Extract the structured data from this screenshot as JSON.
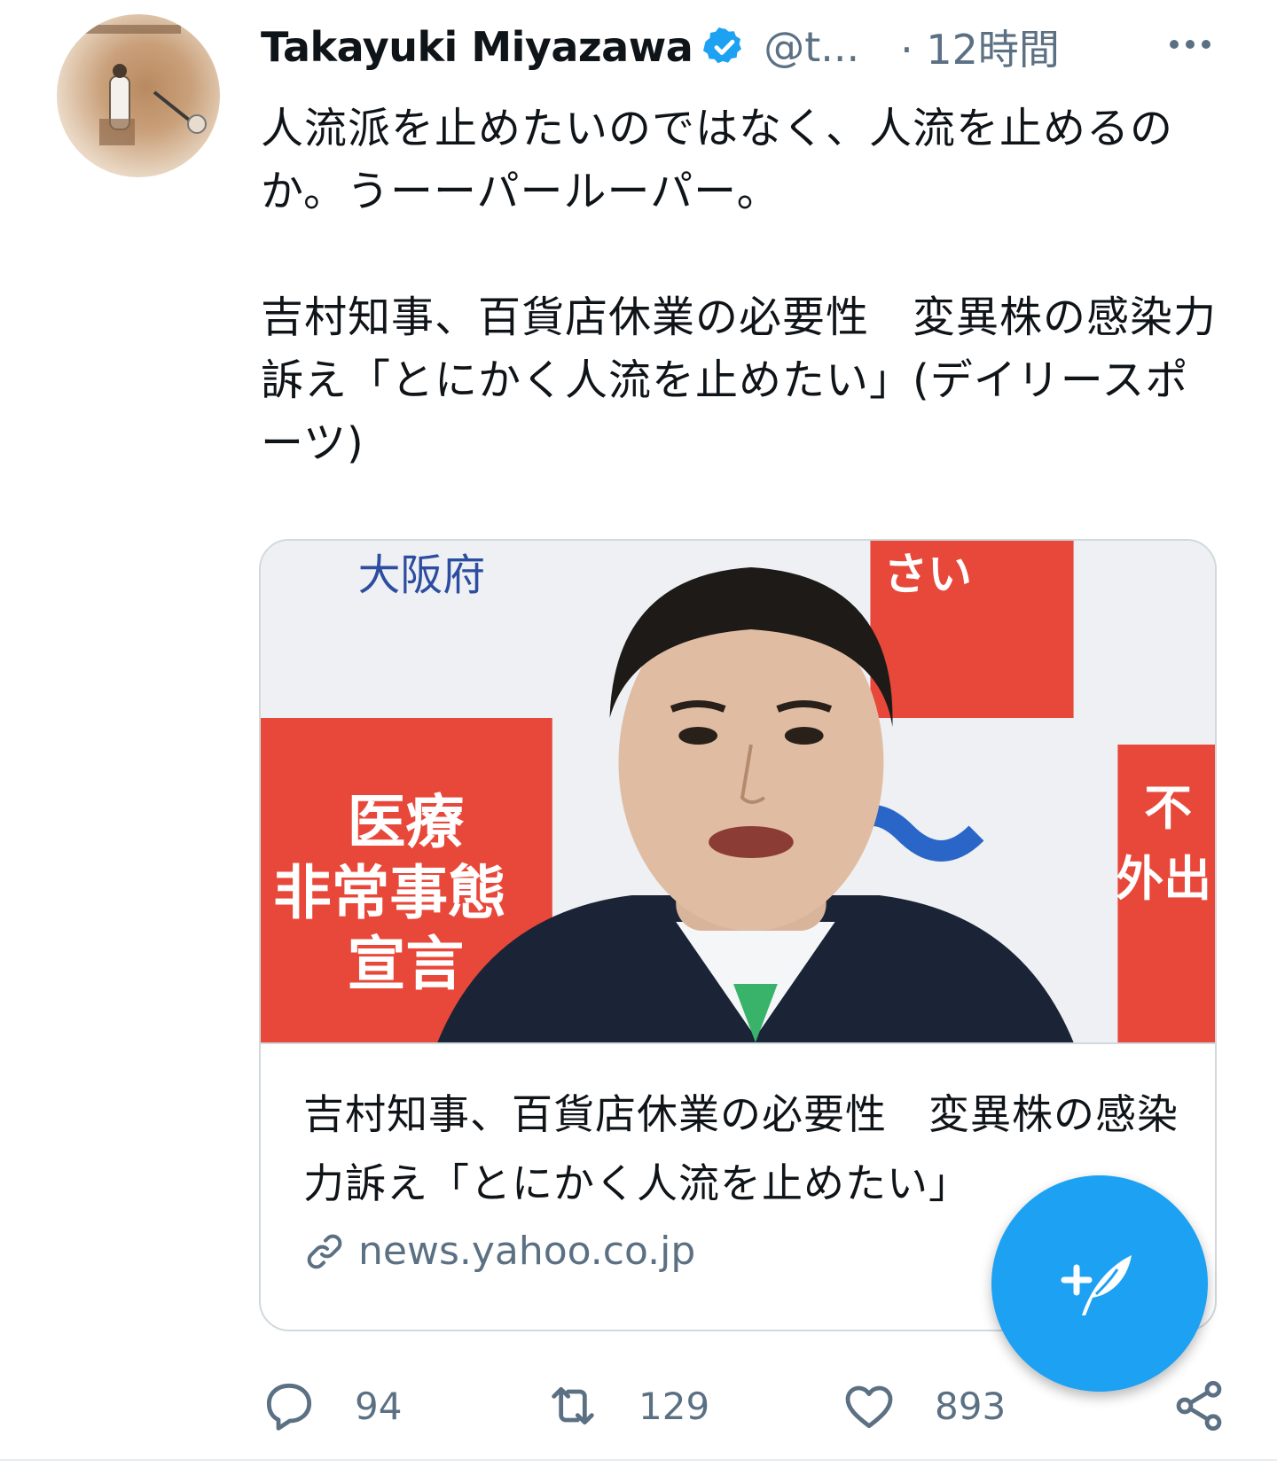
{
  "tweet": {
    "author_name": "Takayuki Miyazawa",
    "handle": "@t...",
    "time": "· 12時間",
    "text_paragraph_1": "人流派を止めたいのではなく、人流を止めるのか。うーーパールーパー。",
    "text_paragraph_2": "吉村知事、百貨店休業の必要性　変異株の感染力訴え「とにかく人流を止めたい」(デイリースポーツ)"
  },
  "card": {
    "image_signs": {
      "top_left": "大阪府",
      "top_right": "さい",
      "left_board": [
        "医療",
        "非常事態",
        "宣言"
      ],
      "right_board": [
        "不",
        "外出"
      ]
    },
    "title": "吉村知事、百貨店休業の必要性　変異株の感染力訴え「とにかく人流を止めたい」",
    "domain": "news.yahoo.co.jp"
  },
  "actions": {
    "reply_count": "94",
    "retweet_count": "129",
    "like_count": "893"
  },
  "colors": {
    "accent": "#1da1f2",
    "muted_text": "#5b7083",
    "border": "#cfd9de"
  },
  "icons": [
    "verified-badge-icon",
    "more-icon",
    "link-icon",
    "reply-icon",
    "retweet-icon",
    "like-icon",
    "share-icon",
    "compose-icon"
  ]
}
